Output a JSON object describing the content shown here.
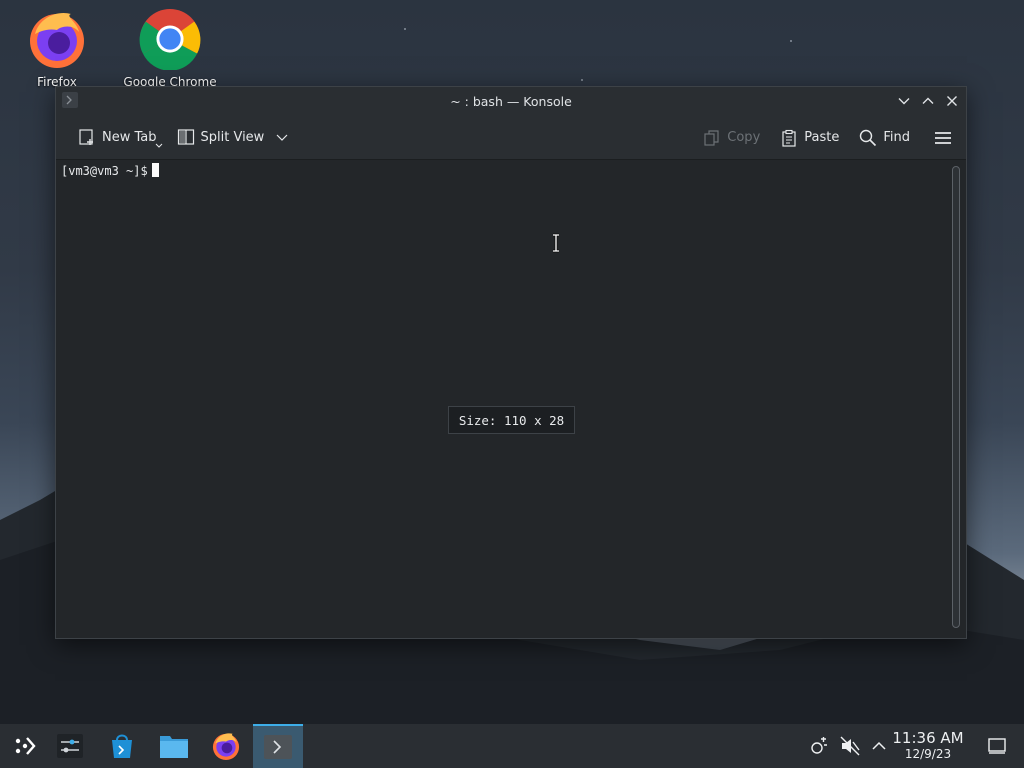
{
  "desktop": {
    "icons": [
      {
        "label": "Firefox",
        "icon": "firefox-icon"
      },
      {
        "label": "Google Chrome",
        "icon": "chrome-icon"
      }
    ]
  },
  "window": {
    "title": "~ : bash — Konsole",
    "toolbar": {
      "new_tab": "New Tab",
      "split_view": "Split View",
      "copy": "Copy",
      "paste": "Paste",
      "find": "Find"
    },
    "terminal": {
      "prompt": "[vm3@vm3 ~]$"
    },
    "size_tooltip": "Size: 110 x 28"
  },
  "taskbar": {
    "apps": [
      "application-launcher-icon",
      "system-settings-icon",
      "discover-icon",
      "dolphin-icon",
      "firefox-icon",
      "konsole-icon"
    ],
    "active_app": "konsole-icon",
    "clock": {
      "time": "11:36 AM",
      "date": "12/9/23"
    }
  },
  "colors": {
    "accent": "#3daee9",
    "window_bg": "#232629",
    "titlebar_bg": "#2a2e32",
    "taskbar_bg": "#2a2e33"
  }
}
